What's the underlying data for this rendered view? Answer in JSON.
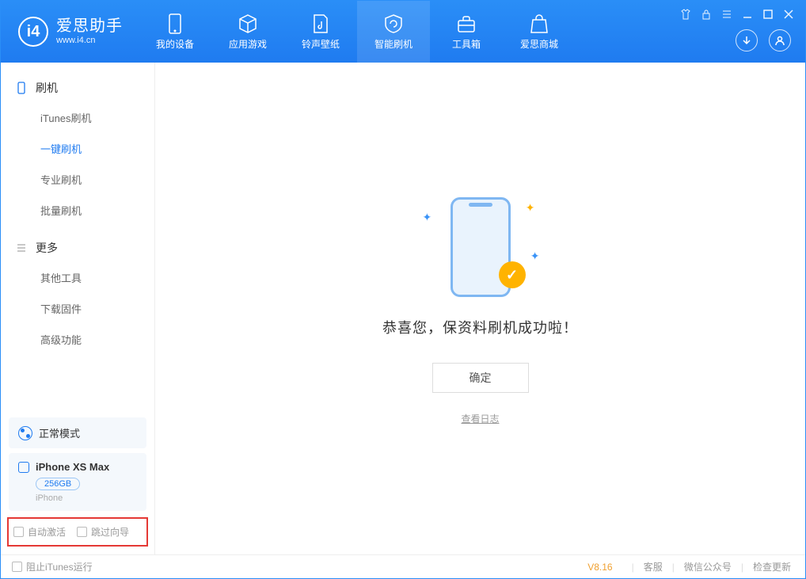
{
  "app": {
    "title": "爱思助手",
    "subtitle": "www.i4.cn"
  },
  "tabs": [
    {
      "label": "我的设备"
    },
    {
      "label": "应用游戏"
    },
    {
      "label": "铃声壁纸"
    },
    {
      "label": "智能刷机"
    },
    {
      "label": "工具箱"
    },
    {
      "label": "爱思商城"
    }
  ],
  "sidebar": {
    "group1": {
      "title": "刷机",
      "items": [
        "iTunes刷机",
        "一键刷机",
        "专业刷机",
        "批量刷机"
      ]
    },
    "group2": {
      "title": "更多",
      "items": [
        "其他工具",
        "下载固件",
        "高级功能"
      ]
    }
  },
  "mode": {
    "label": "正常模式"
  },
  "device": {
    "name": "iPhone XS Max",
    "capacity": "256GB",
    "type": "iPhone"
  },
  "options": {
    "auto_activate": "自动激活",
    "skip_guide": "跳过向导"
  },
  "main": {
    "success_msg": "恭喜您，保资料刷机成功啦！",
    "ok": "确定",
    "view_log": "查看日志"
  },
  "footer": {
    "block_itunes": "阻止iTunes运行",
    "version": "V8.16",
    "links": [
      "客服",
      "微信公众号",
      "检查更新"
    ]
  }
}
